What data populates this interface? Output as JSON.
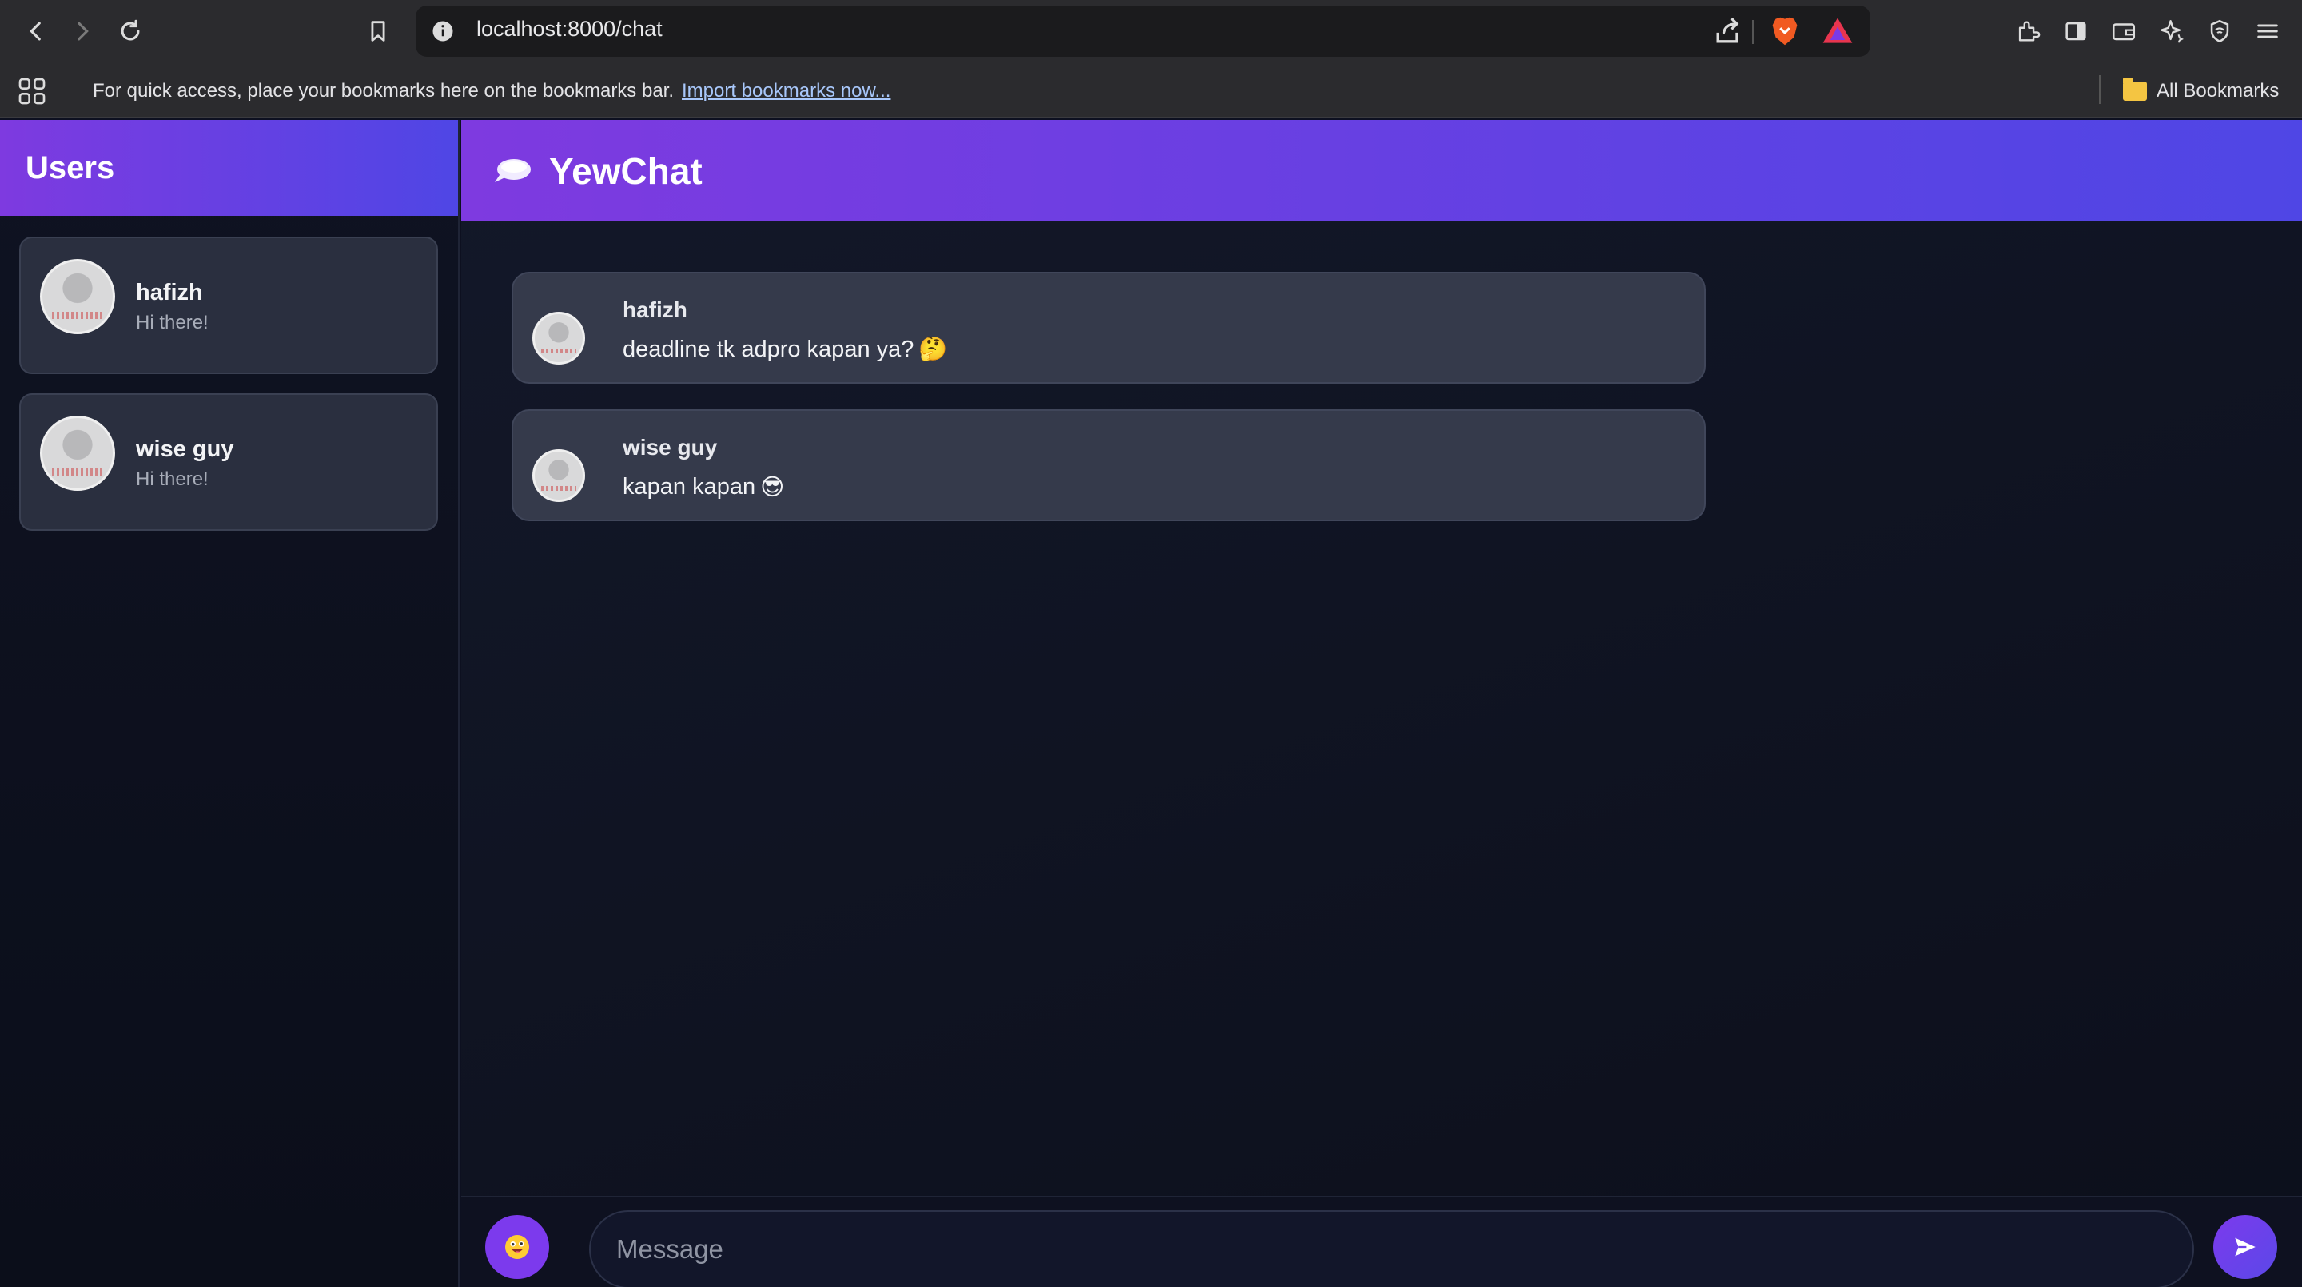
{
  "browser": {
    "url": "localhost:8000/chat",
    "bookmarks_message": "For quick access, place your bookmarks here on the bookmarks bar.",
    "import_link": "Import bookmarks now...",
    "all_bookmarks": "All Bookmarks"
  },
  "sidebar": {
    "title": "Users",
    "users": [
      {
        "name": "hafizh",
        "status": "Hi there!"
      },
      {
        "name": "wise guy",
        "status": "Hi there!"
      }
    ]
  },
  "chat": {
    "title": "YewChat",
    "messages": [
      {
        "from": "hafizh",
        "text": "deadline tk adpro kapan ya?",
        "emoji": "🤔"
      },
      {
        "from": "wise guy",
        "text": "kapan kapan",
        "emoji": "😎"
      }
    ]
  },
  "composer": {
    "placeholder": "Message",
    "emoji_button": "😜"
  },
  "colors": {
    "accent_start": "#7e3ae0",
    "accent_end": "#4f46e5",
    "background": "#0d1020",
    "card": "#353a4b"
  }
}
